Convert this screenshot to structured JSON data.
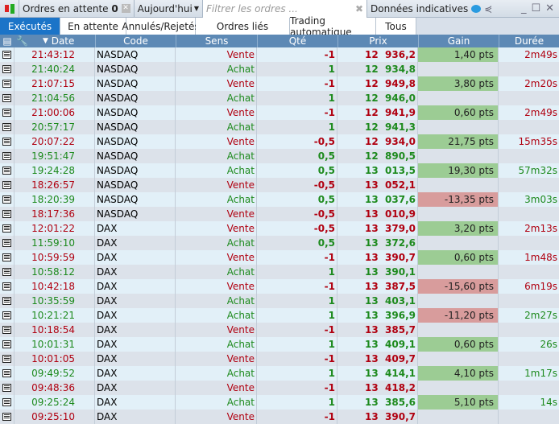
{
  "toolbar": {
    "pending_label": "Ordres en attente",
    "pending_count": "0",
    "period": "Aujourd'hui",
    "filter_placeholder": "Filtrer les ordres ...",
    "indicative": "Données indicatives"
  },
  "tabs": [
    "Exécutés",
    "En attente",
    "Annulés/Rejetés",
    "Ordres liés",
    "Trading automatique",
    "Tous"
  ],
  "columns": [
    "Date",
    "Code",
    "Sens",
    "Qté",
    "Prix",
    "Gain",
    "Durée"
  ],
  "rows": [
    [
      "21:43:12",
      "NASDAQ",
      "Vente",
      "-1",
      "12  936,2",
      "1,40 pts",
      "2m49s"
    ],
    [
      "21:40:24",
      "NASDAQ",
      "Achat",
      "1",
      "12  934,8",
      "",
      ""
    ],
    [
      "21:07:15",
      "NASDAQ",
      "Vente",
      "-1",
      "12  949,8",
      "3,80 pts",
      "2m20s"
    ],
    [
      "21:04:56",
      "NASDAQ",
      "Achat",
      "1",
      "12  946,0",
      "",
      ""
    ],
    [
      "21:00:06",
      "NASDAQ",
      "Vente",
      "-1",
      "12  941,9",
      "0,60 pts",
      "2m49s"
    ],
    [
      "20:57:17",
      "NASDAQ",
      "Achat",
      "1",
      "12  941,3",
      "",
      ""
    ],
    [
      "20:07:22",
      "NASDAQ",
      "Vente",
      "-0,5",
      "12  934,0",
      "21,75 pts",
      "15m35s"
    ],
    [
      "19:51:47",
      "NASDAQ",
      "Achat",
      "0,5",
      "12  890,5",
      "",
      ""
    ],
    [
      "19:24:28",
      "NASDAQ",
      "Achat",
      "0,5",
      "13  013,5",
      "19,30 pts",
      "57m32s"
    ],
    [
      "18:26:57",
      "NASDAQ",
      "Vente",
      "-0,5",
      "13  052,1",
      "",
      ""
    ],
    [
      "18:20:39",
      "NASDAQ",
      "Achat",
      "0,5",
      "13  037,6",
      "-13,35 pts",
      "3m03s"
    ],
    [
      "18:17:36",
      "NASDAQ",
      "Vente",
      "-0,5",
      "13  010,9",
      "",
      ""
    ],
    [
      "12:01:22",
      "DAX",
      "Vente",
      "-0,5",
      "13  379,0",
      "3,20 pts",
      "2m13s"
    ],
    [
      "11:59:10",
      "DAX",
      "Achat",
      "0,5",
      "13  372,6",
      "",
      ""
    ],
    [
      "10:59:59",
      "DAX",
      "Vente",
      "-1",
      "13  390,7",
      "0,60 pts",
      "1m48s"
    ],
    [
      "10:58:12",
      "DAX",
      "Achat",
      "1",
      "13  390,1",
      "",
      ""
    ],
    [
      "10:42:18",
      "DAX",
      "Vente",
      "-1",
      "13  387,5",
      "-15,60 pts",
      "6m19s"
    ],
    [
      "10:35:59",
      "DAX",
      "Achat",
      "1",
      "13  403,1",
      "",
      ""
    ],
    [
      "10:21:21",
      "DAX",
      "Achat",
      "1",
      "13  396,9",
      "-11,20 pts",
      "2m27s"
    ],
    [
      "10:18:54",
      "DAX",
      "Vente",
      "-1",
      "13  385,7",
      "",
      ""
    ],
    [
      "10:01:31",
      "DAX",
      "Achat",
      "1",
      "13  409,1",
      "0,60 pts",
      "26s"
    ],
    [
      "10:01:05",
      "DAX",
      "Vente",
      "-1",
      "13  409,7",
      "",
      ""
    ],
    [
      "09:49:52",
      "DAX",
      "Achat",
      "1",
      "13  414,1",
      "4,10 pts",
      "1m17s"
    ],
    [
      "09:48:36",
      "DAX",
      "Vente",
      "-1",
      "13  418,2",
      "",
      ""
    ],
    [
      "09:25:24",
      "DAX",
      "Achat",
      "1",
      "13  385,6",
      "5,10 pts",
      "14s"
    ],
    [
      "09:25:10",
      "DAX",
      "Vente",
      "-1",
      "13  390,7",
      "",
      ""
    ]
  ]
}
